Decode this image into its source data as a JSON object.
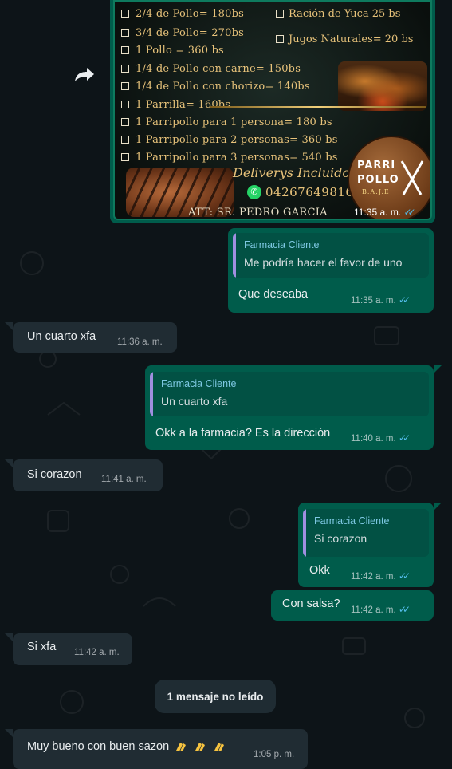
{
  "menu_image": {
    "items_left": [
      "2/4 de Pollo= 180bs",
      "3/4 de Pollo= 270bs",
      "1 Pollo = 360 bs",
      "1/4 de Pollo con carne= 150bs",
      "1/4 de Pollo con chorizo= 140bs",
      "1 Parrilla= 160bs",
      "1 Parripollo para 1 persona= 180 bs",
      "1 Parripollo para 2 personas= 360 bs",
      "1 Parripollo para 3 personas= 540 bs"
    ],
    "items_right": [
      "Ración de Yuca 25 bs",
      "Jugos Naturales= 20 bs"
    ],
    "delivery": "Deliverys Incluidos",
    "phone": "04267649816",
    "logo_line1": "PARRI",
    "logo_line2": "POLLO",
    "logo_sub": "B.A.J.E",
    "attention": "ATT: SR. PEDRO GARCIA",
    "time": "11:35 a. m."
  },
  "messages": [
    {
      "dir": "out",
      "quote_author": "Farmacia Cliente",
      "quote_text": "Me podría hacer el favor de uno",
      "text": "Que deseaba",
      "time": "11:35 a. m."
    },
    {
      "dir": "in",
      "text": "Un cuarto xfa",
      "time": "11:36 a. m."
    },
    {
      "dir": "out",
      "quote_author": "Farmacia Cliente",
      "quote_text": "Un cuarto xfa",
      "text": "Okk a la farmacia? Es la dirección",
      "time": "11:40 a. m."
    },
    {
      "dir": "in",
      "text": "Si corazon",
      "time": "11:41 a. m."
    },
    {
      "dir": "out",
      "quote_author": "Farmacia Cliente",
      "quote_text": "Si corazon",
      "text": "Okk",
      "time": "11:42 a. m."
    },
    {
      "dir": "out",
      "text": "Con salsa?",
      "time": "11:42 a. m."
    },
    {
      "dir": "in",
      "text": "Si xfa",
      "time": "11:42 a. m."
    },
    {
      "dir": "in",
      "text": "Muy bueno con buen sazon",
      "time": "1:05 p. m."
    }
  ],
  "unread_label": "1 mensaje no leído",
  "ticks": "✓✓",
  "icons": {
    "forward": "forward-arrow-icon",
    "whatsapp": "whatsapp-icon",
    "clap": "clapping-hands-icon"
  },
  "colors": {
    "bg": "#0d1418",
    "outgoing": "#005c4b",
    "incoming": "#202c33",
    "read_ticks": "#53bdeb"
  }
}
